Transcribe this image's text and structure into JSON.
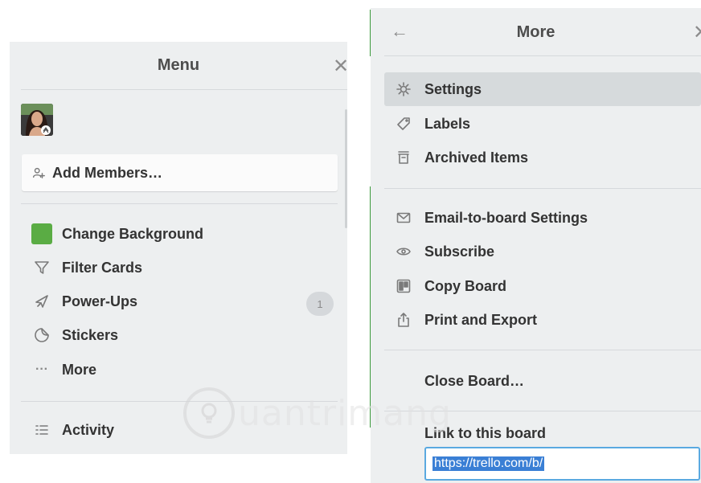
{
  "menu": {
    "title": "Menu",
    "close_icon": "close-icon",
    "add_members_label": "Add Members…",
    "items": [
      {
        "label": "Change Background",
        "icon": "color-swatch"
      },
      {
        "label": "Filter Cards",
        "icon": "filter-icon"
      },
      {
        "label": "Power-Ups",
        "icon": "rocket-icon",
        "badge": "1"
      },
      {
        "label": "Stickers",
        "icon": "sticker-icon"
      },
      {
        "label": "More",
        "icon": "ellipsis-icon"
      }
    ],
    "activity_label": "Activity",
    "background_color": "#5aac44"
  },
  "more": {
    "title": "More",
    "items": [
      {
        "label": "Settings",
        "icon": "gear-icon",
        "selected": true
      },
      {
        "label": "Labels",
        "icon": "tag-icon"
      },
      {
        "label": "Archived Items",
        "icon": "archive-icon"
      },
      {
        "label": "Email-to-board Settings",
        "icon": "mail-icon"
      },
      {
        "label": "Subscribe",
        "icon": "eye-icon"
      },
      {
        "label": "Copy Board",
        "icon": "copy-board-icon"
      },
      {
        "label": "Print and Export",
        "icon": "share-icon"
      }
    ],
    "close_board_label": "Close Board…",
    "link_label": "Link to this board",
    "link_url": "https://trello.com/b/"
  },
  "watermark_text": "uantrimang"
}
